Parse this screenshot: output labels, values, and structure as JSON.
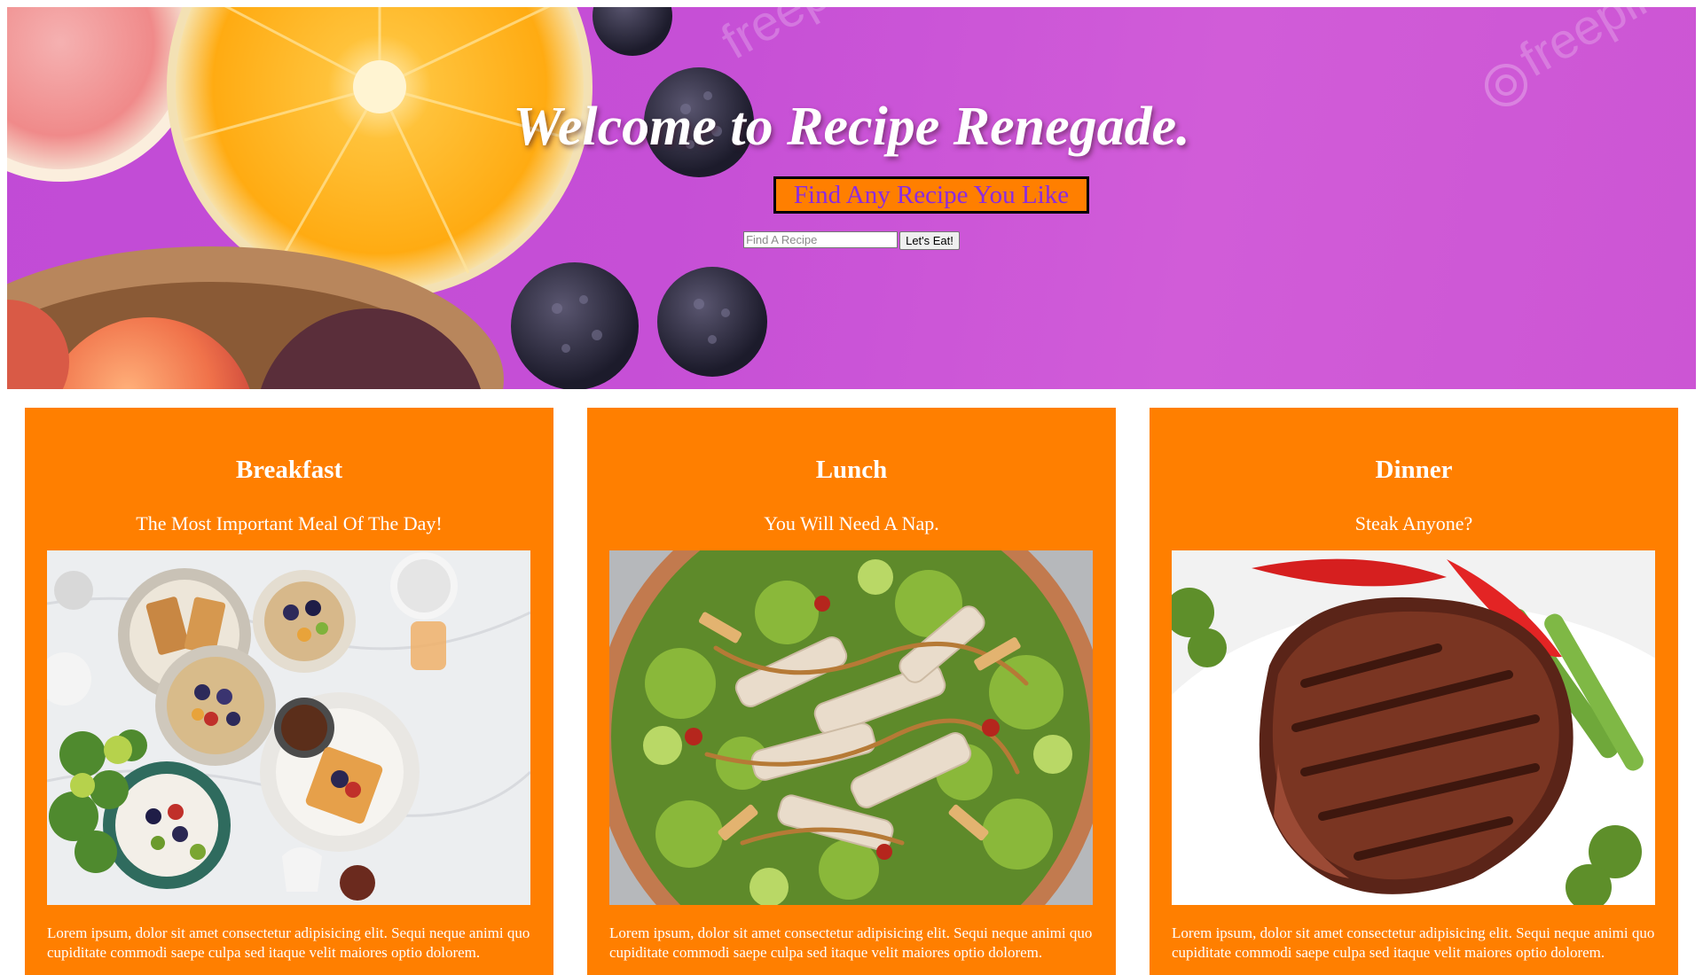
{
  "hero": {
    "title": "Welcome to Recipe Renegade.",
    "subtitle": "Find Any Recipe You Like",
    "search": {
      "placeholder": "Find A Recipe",
      "value": "",
      "button_label": "Let's Eat!"
    },
    "watermark": "freepik"
  },
  "cards": [
    {
      "title": "Breakfast",
      "subtitle": "The Most Important Meal Of The Day!",
      "body": "Lorem ipsum, dolor sit amet consectetur adipisicing elit. Sequi neque animi quo cupiditate commodi saepe culpa sed itaque velit maiores optio dolorem."
    },
    {
      "title": "Lunch",
      "subtitle": "You Will Need A Nap.",
      "body": "Lorem ipsum, dolor sit amet consectetur adipisicing elit. Sequi neque animi quo cupiditate commodi saepe culpa sed itaque velit maiores optio dolorem."
    },
    {
      "title": "Dinner",
      "subtitle": "Steak Anyone?",
      "body": "Lorem ipsum, dolor sit amet consectetur adipisicing elit. Sequi neque animi quo cupiditate commodi saepe culpa sed itaque velit maiores optio dolorem."
    }
  ],
  "colors": {
    "card_background": "#ff7f00",
    "hero_background": "#c64fd6",
    "subtitle_text": "#8a2be2",
    "text_light": "#ffffff"
  },
  "icons": {
    "hero_image": "fruit-photo",
    "breakfast_image": "breakfast-photo",
    "lunch_image": "salad-photo",
    "dinner_image": "steak-photo"
  }
}
